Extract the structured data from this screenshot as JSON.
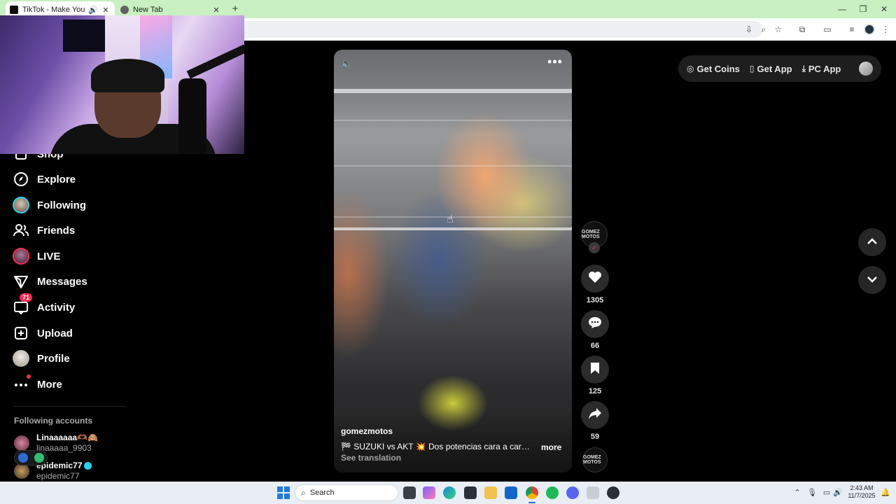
{
  "browser": {
    "tabs": [
      {
        "title": "TikTok - Make Your Day",
        "active": true
      },
      {
        "title": "New Tab",
        "active": false
      }
    ]
  },
  "sidebar": {
    "items": [
      {
        "label": "Shop",
        "icon": "shop-icon"
      },
      {
        "label": "Explore",
        "icon": "compass-icon"
      },
      {
        "label": "Following",
        "icon": "following-avatar"
      },
      {
        "label": "Friends",
        "icon": "friends-icon"
      },
      {
        "label": "LIVE",
        "icon": "live-avatar"
      },
      {
        "label": "Messages",
        "icon": "paper-plane-icon"
      },
      {
        "label": "Activity",
        "icon": "inbox-icon",
        "badge": "71"
      },
      {
        "label": "Upload",
        "icon": "plus-square-icon"
      },
      {
        "label": "Profile",
        "icon": "profile-avatar"
      },
      {
        "label": "More",
        "icon": "more-dots-icon"
      }
    ],
    "following_title": "Following accounts",
    "accounts": [
      {
        "display_name": "Linaaaaaa🫶🏾🙈",
        "username": "linaaaaa_9903"
      },
      {
        "display_name": "epidemic77",
        "username": "epidemic77",
        "verified": true
      }
    ]
  },
  "video": {
    "author": "gomezmotos",
    "description": "🏁 SUZUKI vs AKT 💥 Dos potencias cara a cara ...",
    "more_label": "more",
    "translate_label": "See translation",
    "creator_logo_text": "GOMEZ MOTOS"
  },
  "actions": {
    "likes": "1305",
    "comments": "66",
    "saves": "125",
    "shares": "59"
  },
  "header": {
    "get_coins": "Get Coins",
    "get_app": "Get App",
    "pc_app": "PC App"
  },
  "taskbar": {
    "search_label": "Search",
    "time": "2:43 AM",
    "date": "11/7/2025"
  },
  "colors": {
    "accent": "#fe2c55",
    "background": "#000000",
    "tabbar": "#c8f0c0",
    "verified": "#20d5ec"
  }
}
